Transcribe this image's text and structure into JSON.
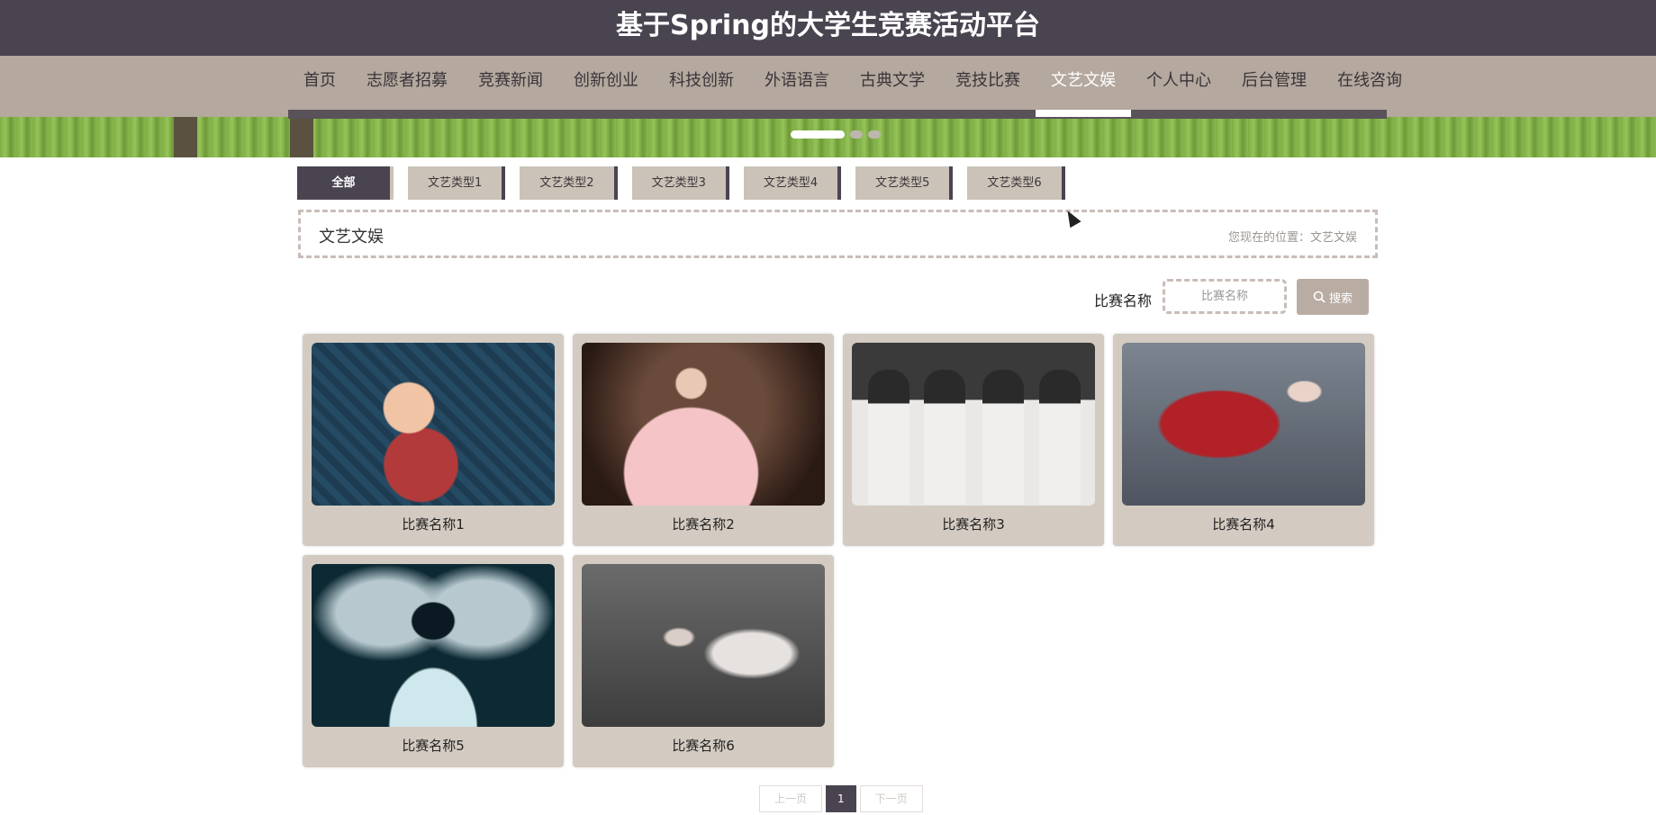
{
  "site": {
    "title": "基于Spring的大学生竞赛活动平台"
  },
  "nav": {
    "items": [
      {
        "label": "首页"
      },
      {
        "label": "志愿者招募"
      },
      {
        "label": "竞赛新闻"
      },
      {
        "label": "创新创业"
      },
      {
        "label": "科技创新"
      },
      {
        "label": "外语语言"
      },
      {
        "label": "古典文学"
      },
      {
        "label": "竞技比赛"
      },
      {
        "label": "文艺文娱"
      },
      {
        "label": "个人中心"
      },
      {
        "label": "后台管理"
      },
      {
        "label": "在线咨询"
      }
    ],
    "active": "文艺文娱"
  },
  "banner": {
    "slides": 3,
    "active_slide": 1
  },
  "categories": {
    "items": [
      {
        "label": "全部"
      },
      {
        "label": "文艺类型1"
      },
      {
        "label": "文艺类型2"
      },
      {
        "label": "文艺类型3"
      },
      {
        "label": "文艺类型4"
      },
      {
        "label": "文艺类型5"
      },
      {
        "label": "文艺类型6"
      }
    ],
    "active": "全部"
  },
  "section": {
    "title": "文艺文娱",
    "breadcrumb_prefix": "您现在的位置：",
    "breadcrumb_current": "文艺文娱"
  },
  "search": {
    "label": "比赛名称",
    "placeholder": "比赛名称",
    "button_label": "搜索"
  },
  "cards": [
    {
      "name": "比赛名称1"
    },
    {
      "name": "比赛名称2"
    },
    {
      "name": "比赛名称3"
    },
    {
      "name": "比赛名称4"
    },
    {
      "name": "比赛名称5"
    },
    {
      "name": "比赛名称6"
    }
  ],
  "pagination": {
    "prev_label": "上一页",
    "current_page": "1",
    "next_label": "下一页"
  },
  "colors": {
    "header_bg": "#4a4450",
    "nav_bg": "#b4a89f",
    "card_bg": "#d3cbc1",
    "accent": "#4a4450"
  }
}
